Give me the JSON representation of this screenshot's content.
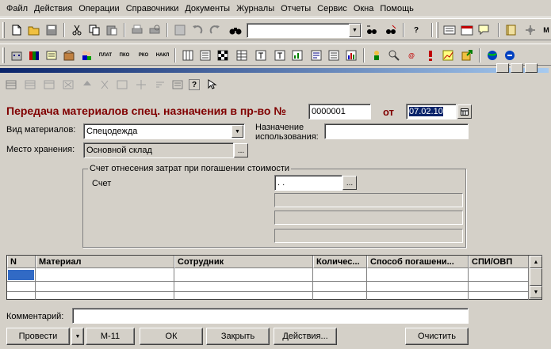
{
  "menu": [
    "Файл",
    "Действия",
    "Операции",
    "Справочники",
    "Документы",
    "Журналы",
    "Отчеты",
    "Сервис",
    "Окна",
    "Помощь"
  ],
  "toolbar2_labels": [
    "ПЛАТ",
    "ПКО",
    "РКО",
    "НАКЛ"
  ],
  "form": {
    "title": "Передача материалов спец. назначения в пр-во №",
    "doc_number": "0000001",
    "date_label": "от",
    "date_value": "07.02.10",
    "material_type_label": "Вид материалов:",
    "material_type_value": "Спецодежда",
    "purpose_label_1": "Назначение",
    "purpose_label_2": "использования:",
    "purpose_value": "",
    "storage_label": "Место хранения:",
    "storage_value": "Основной склад",
    "group_title": "Счет отнесения затрат при погашении стоимости",
    "account_label": "Счет",
    "account_value": " .  ."
  },
  "grid": {
    "columns": [
      "N",
      "Материал",
      "Сотрудник",
      "Количес...",
      "Способ погашени...",
      "СПИ/ОВП"
    ]
  },
  "comment_label": "Комментарий:",
  "comment_value": "",
  "buttons": {
    "post": "Провести",
    "m11": "М-11",
    "ok": "ОК",
    "close": "Закрыть",
    "actions": "Действия...",
    "clear": "Очистить"
  },
  "colors": {
    "title_color": "#800000",
    "selection": "#0a246a",
    "chrome": "#d4d0c8"
  }
}
